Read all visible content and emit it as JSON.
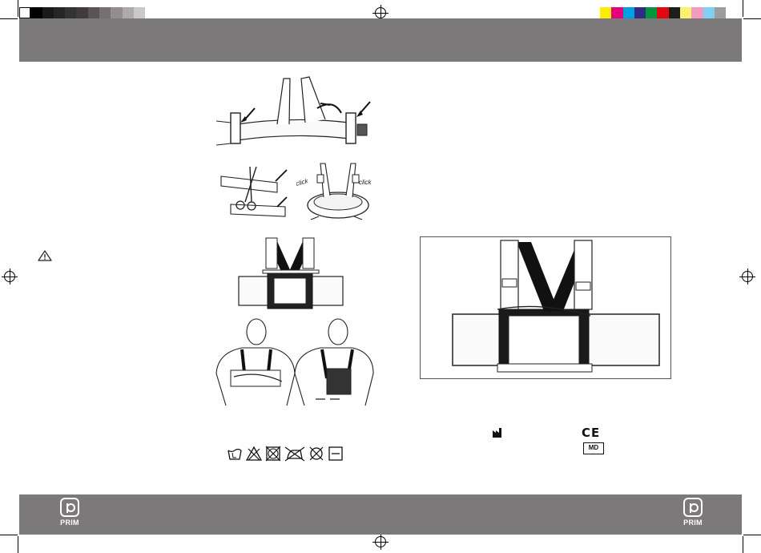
{
  "brand": {
    "name": "PRIM"
  },
  "illustrations": [
    {
      "id": "belt-with-shoulder-straps",
      "caption": ""
    },
    {
      "id": "cutting-adjustment",
      "annotation": "click"
    },
    {
      "id": "click-assembly",
      "annotation_left": "click",
      "annotation_right": "click"
    },
    {
      "id": "assembled-brace"
    },
    {
      "id": "wearing-brace"
    },
    {
      "id": "assembled-brace-framed"
    }
  ],
  "symbols": {
    "care": [
      "hand-wash-icon",
      "no-bleach-icon",
      "no-tumble-dry-icon",
      "no-iron-icon",
      "no-dry-clean-icon",
      "flat-dry-icon"
    ],
    "ce_label": "CE",
    "md_label": "MD",
    "manufacturer": "manufacturer-icon",
    "warning": "warning-icon"
  },
  "color_bar": {
    "gray": [
      "#ffffff",
      "#000000",
      "#1a1a1a",
      "#262626",
      "#333333",
      "#403c3c",
      "#5a5555",
      "#767171",
      "#928e8e",
      "#aeaaaa",
      "#cbc8c8",
      "#ffffff"
    ],
    "process": [
      "#ffed00",
      "#e5007d",
      "#009fe3",
      "#2d2e83",
      "#009640",
      "#e30613",
      "#1d1d1b",
      "#fff36d",
      "#f39ac1",
      "#7fd0f3",
      "#9d9d9c"
    ]
  },
  "band_color": "#7b7979"
}
